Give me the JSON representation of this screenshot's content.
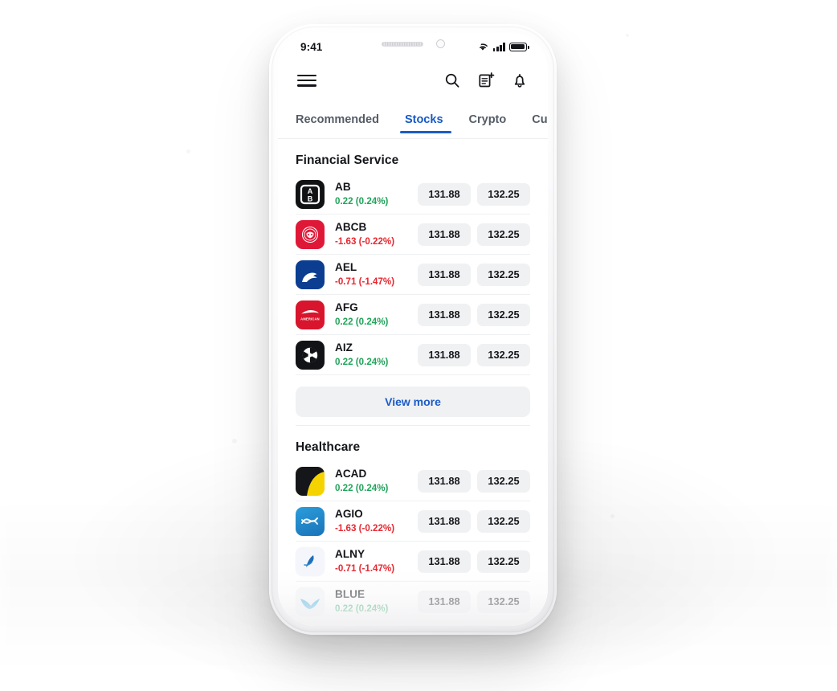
{
  "status_bar": {
    "time": "9:41",
    "wifi_icon": "wifi-icon",
    "signal_icon": "cellular-signal-icon",
    "battery_icon": "battery-icon"
  },
  "app_bar": {
    "menu_icon": "hamburger-menu-icon",
    "search_icon": "search-icon",
    "compose_icon": "add-note-icon",
    "notifications_icon": "bell-icon"
  },
  "tabs": [
    {
      "label": "Recommended",
      "active": false
    },
    {
      "label": "Stocks",
      "active": true
    },
    {
      "label": "Crypto",
      "active": false
    },
    {
      "label": "Currenci",
      "active": false
    }
  ],
  "colors": {
    "accent": "#1a5cc8",
    "up": "#21a45a",
    "down": "#e8262f",
    "pill_bg": "#f0f1f3",
    "text": "#14161a"
  },
  "sections": [
    {
      "title": "Financial Service",
      "view_more_label": "View more",
      "rows": [
        {
          "symbol": "AB",
          "change": "0.22 (0.24%)",
          "direction": "up",
          "price_1": "131.88",
          "price_2": "132.25",
          "logo": "ab-logo"
        },
        {
          "symbol": "ABCB",
          "change": "-1.63 (-0.22%)",
          "direction": "down",
          "price_1": "131.88",
          "price_2": "132.25",
          "logo": "abcb-logo"
        },
        {
          "symbol": "AEL",
          "change": "-0.71 (-1.47%)",
          "direction": "down",
          "price_1": "131.88",
          "price_2": "132.25",
          "logo": "ael-logo"
        },
        {
          "symbol": "AFG",
          "change": "0.22 (0.24%)",
          "direction": "up",
          "price_1": "131.88",
          "price_2": "132.25",
          "logo": "afg-logo"
        },
        {
          "symbol": "AIZ",
          "change": "0.22 (0.24%)",
          "direction": "up",
          "price_1": "131.88",
          "price_2": "132.25",
          "logo": "aiz-logo"
        }
      ]
    },
    {
      "title": "Healthcare",
      "rows": [
        {
          "symbol": "ACAD",
          "change": "0.22 (0.24%)",
          "direction": "up",
          "price_1": "131.88",
          "price_2": "132.25",
          "logo": "acad-logo"
        },
        {
          "symbol": "AGIO",
          "change": "-1.63 (-0.22%)",
          "direction": "down",
          "price_1": "131.88",
          "price_2": "132.25",
          "logo": "agio-logo"
        },
        {
          "symbol": "ALNY",
          "change": "-0.71 (-1.47%)",
          "direction": "down",
          "price_1": "131.88",
          "price_2": "132.25",
          "logo": "alny-logo"
        },
        {
          "symbol": "BLUE",
          "change": "0.22 (0.24%)",
          "direction": "up",
          "price_1": "131.88",
          "price_2": "132.25",
          "logo": "blue-logo"
        }
      ]
    }
  ]
}
